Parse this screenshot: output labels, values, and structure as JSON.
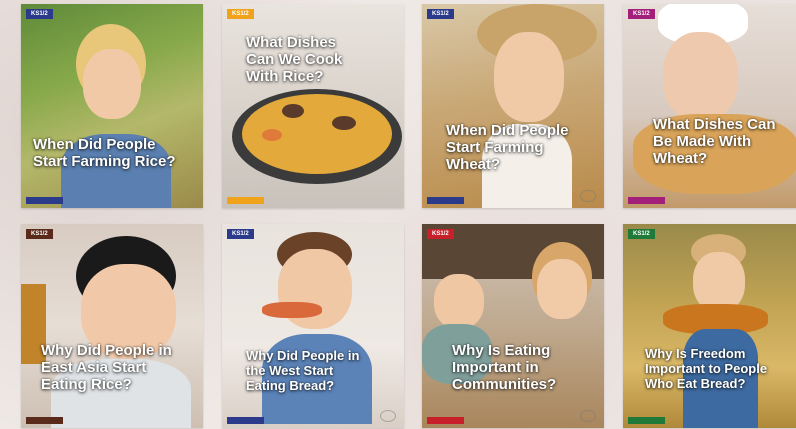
{
  "cards": [
    {
      "badge": "KS1/2",
      "badge_color": "#2c3a8c",
      "title": "When Did People Start Farming Rice?",
      "tag_color": "#2c3a8c"
    },
    {
      "badge": "KS1/2",
      "badge_color": "#f0a21a",
      "title": "What Dishes Can We Cook With Rice?",
      "tag_color": "#f0a21a"
    },
    {
      "badge": "KS1/2",
      "badge_color": "#2c3a8c",
      "title": "When Did People Start Farming Wheat?",
      "tag_color": "#2c3a8c"
    },
    {
      "badge": "KS1/2",
      "badge_color": "#a3207a",
      "title": "What Dishes Can Be Made With Wheat?",
      "tag_color": "#a3207a"
    },
    {
      "badge": "KS1/2",
      "badge_color": "#5a2a1a",
      "title": "Why Did People in East Asia Start Eating Rice?",
      "tag_color": "#5a2a1a"
    },
    {
      "badge": "KS1/2",
      "badge_color": "#2c3a8c",
      "title": "Why Did People in the West Start Eating Bread?",
      "tag_color": "#2c3a8c"
    },
    {
      "badge": "KS1/2",
      "badge_color": "#c8202a",
      "title": "Why Is Eating Important in Communities?",
      "tag_color": "#c8202a"
    },
    {
      "badge": "KS1/2",
      "badge_color": "#1f7a3a",
      "title": "Why Is Freedom Important to People Who Eat Bread?",
      "tag_color": "#1f7a3a"
    }
  ]
}
